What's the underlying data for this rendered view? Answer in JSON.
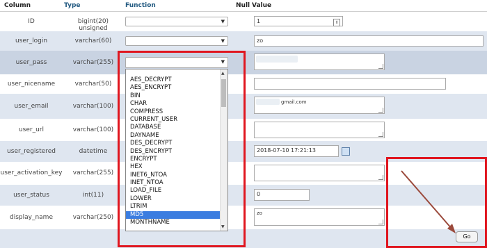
{
  "header": {
    "column": "Column",
    "type": "Type",
    "function": "Function",
    "null": "Null",
    "value": "Value"
  },
  "rows": [
    {
      "name": "ID",
      "type": "bigint(20) unsigned",
      "value": "1"
    },
    {
      "name": "user_login",
      "type": "varchar(60)",
      "value": "zo"
    },
    {
      "name": "user_pass",
      "type": "varchar(255)",
      "value": ""
    },
    {
      "name": "user_nicename",
      "type": "varchar(50)",
      "value": ""
    },
    {
      "name": "user_email",
      "type": "varchar(100)",
      "value": "gmail.com"
    },
    {
      "name": "user_url",
      "type": "varchar(100)",
      "value": ""
    },
    {
      "name": "user_registered",
      "type": "datetime",
      "value": "2018-07-10 17:21:13"
    },
    {
      "name": "user_activation_key",
      "type": "varchar(255)",
      "value": ""
    },
    {
      "name": "user_status",
      "type": "int(11)",
      "value": "0"
    },
    {
      "name": "display_name",
      "type": "varchar(250)",
      "value": "zo"
    }
  ],
  "function_options": [
    "AES_DECRYPT",
    "AES_ENCRYPT",
    "BIN",
    "CHAR",
    "COMPRESS",
    "CURRENT_USER",
    "DATABASE",
    "DAYNAME",
    "DES_DECRYPT",
    "DES_ENCRYPT",
    "ENCRYPT",
    "HEX",
    "INET6_NTOA",
    "INET_NTOA",
    "LOAD_FILE",
    "LOWER",
    "LTRIM",
    "MD5",
    "MONTHNAME"
  ],
  "selected_function": "MD5",
  "go_label": "Go",
  "colors": {
    "header_blue": "#235a81",
    "row_alt": "#dfe6f0",
    "highlight_box": "#e0161f",
    "selected_item": "#3b7de0",
    "arrow": "#9b4a3c"
  }
}
